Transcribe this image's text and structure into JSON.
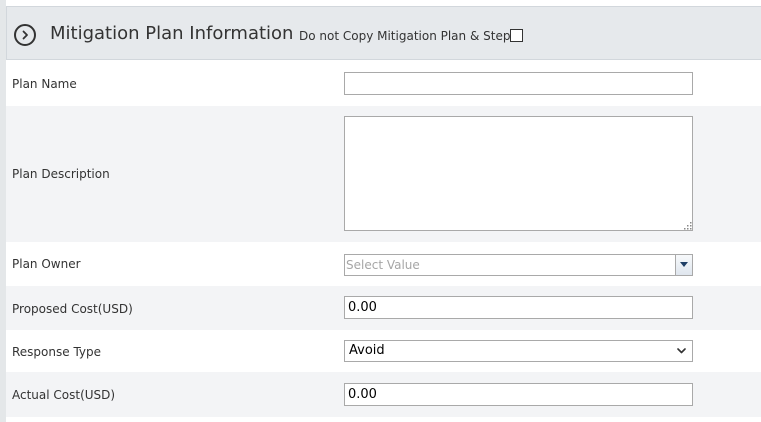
{
  "header": {
    "title": "Mitigation Plan Information",
    "copy_label": "Do not Copy Mitigation Plan & Steps",
    "copy_checked": false,
    "collapse_icon": "chevron-right-circle-icon"
  },
  "fields": {
    "plan_name": {
      "label": "Plan Name",
      "value": ""
    },
    "plan_description": {
      "label": "Plan Description",
      "value": ""
    },
    "plan_owner": {
      "label": "Plan Owner",
      "placeholder": "Select Value",
      "icon": "dropdown-arrow-icon"
    },
    "proposed_cost": {
      "label": "Proposed Cost(USD)",
      "value": "0.00"
    },
    "response_type": {
      "label": "Response Type",
      "value": "Avoid",
      "icon": "chevron-down-icon"
    },
    "actual_cost": {
      "label": "Actual Cost(USD)",
      "value": "0.00"
    }
  },
  "colors": {
    "header_bg": "#e6e9ec",
    "row_shade": "#f3f4f6",
    "input_border": "#a9a9a9",
    "combo_arrow": "#1f3f66"
  }
}
